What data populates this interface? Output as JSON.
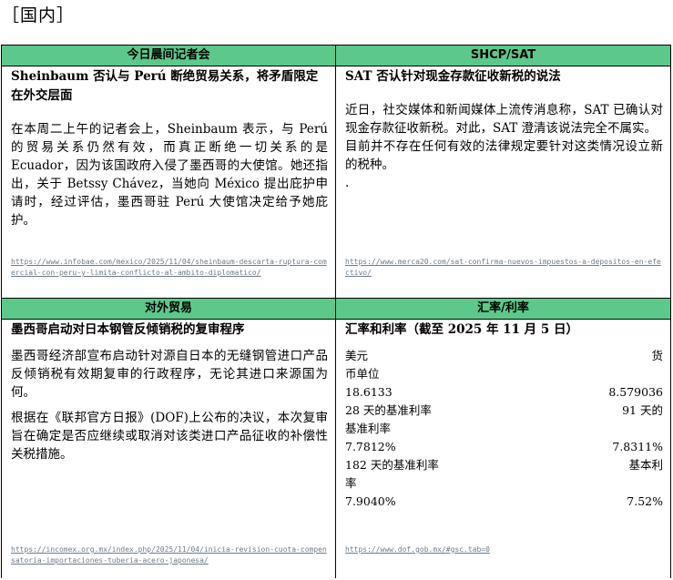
{
  "section_heading": "［国内］",
  "cells": {
    "morning": {
      "header": "今日晨间记者会",
      "title": "Sheinbaum 否认与 Perú 断绝贸易关系，将矛盾限定在外交层面",
      "paragraphs": [
        "在本周二上午的记者会上，Sheinbaum 表示，与 Perú 的贸易关系仍然有效，而真正断绝一切关系的是 Ecuador，因为该国政府入侵了墨西哥的大使馆。她还指出，关于 Betssy Chávez，当她向 México 提出庇护申请时，经过评估，墨西哥驻 Perú 大使馆决定给予她庇护。"
      ],
      "link": "https://www.infobae.com/mexico/2025/11/04/sheinbaum-descarta-ruptura-comercial-con-peru-y-limita-conflicto-al-ambito-diplomatico/"
    },
    "shcp": {
      "header": "SHCP/SAT",
      "title": "SAT 否认针对现金存款征收新税的说法",
      "paragraphs": [
        "近日，社交媒体和新闻媒体上流传消息称，SAT 已确认对现金存款征收新税。对此，SAT 澄清该说法完全不属实。",
        "目前并不存在任何有效的法律规定要针对这类情况设立新的税种。",
        "."
      ],
      "link": "https://www.merca20.com/sat-confirma-nuevos-impuestos-a-depositos-en-efectivo/"
    },
    "trade": {
      "header": "对外贸易",
      "title": "墨西哥启动对日本钢管反倾销税的复审程序",
      "paragraphs": [
        "墨西哥经济部宣布启动针对源自日本的无缝钢管进口产品反倾销税有效期复审的行政程序，无论其进口来源国为何。",
        "根据在《联邦官方日报》(DOF)上公布的决议，本次复审旨在确定是否应继续或取消对该类进口产品征收的补偿性关税措施。"
      ],
      "link": "https://incomex.org.mx/index.php/2025/11/04/inicia-revision-cuota-compensatoria-importaciones-tuberia-acero-japonesa/"
    },
    "rates": {
      "header": "汇率/利率",
      "title": "汇率和利率（截至 2025 年 11 月 5 日）",
      "rows": [
        {
          "left": "美元",
          "right": "货"
        },
        {
          "left": "币单位",
          "right": ""
        },
        {
          "left": "18.6133",
          "right": "8.579036"
        },
        {
          "left": "28 天的基准利率",
          "right": "91 天的"
        },
        {
          "left": "基准利率",
          "right": ""
        },
        {
          "left": "7.7812%",
          "right": "7.8311%"
        },
        {
          "left": "182 天的基准利率",
          "right": "基本利"
        },
        {
          "left": "率",
          "right": ""
        },
        {
          "left": "7.9040%",
          "right": "7.52%"
        }
      ],
      "link": "https://www.dof.gob.mx/#gsc.tab=0"
    }
  }
}
